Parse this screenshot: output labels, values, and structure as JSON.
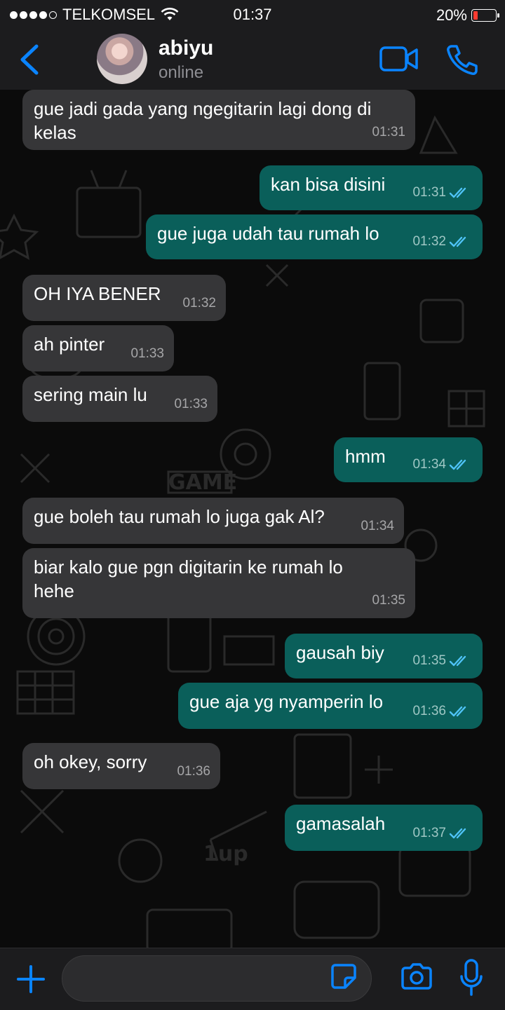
{
  "status_bar": {
    "carrier": "TELKOMSEL",
    "time": "01:37",
    "battery": "20%",
    "battery_level": 0.2
  },
  "header": {
    "name": "abiyu",
    "status": "online"
  },
  "colors": {
    "accent": "#0a84ff",
    "incoming": "#363638",
    "outgoing": "#0a5f5a",
    "read_tick": "#4fc3f7"
  },
  "messages": [
    {
      "dir": "in",
      "text": "gue jadi gada yang ngegitarin lagi dong di\nkelas",
      "time": "01:31"
    },
    {
      "dir": "out",
      "text": "kan bisa disini",
      "time": "01:31"
    },
    {
      "dir": "out",
      "text": "gue juga udah tau rumah lo",
      "time": "01:32"
    },
    {
      "dir": "in",
      "text": "OH IYA BENER",
      "time": "01:32"
    },
    {
      "dir": "in",
      "text": "ah pinter",
      "time": "01:33"
    },
    {
      "dir": "in",
      "text": "sering main lu",
      "time": "01:33"
    },
    {
      "dir": "out",
      "text": "hmm",
      "time": "01:34"
    },
    {
      "dir": "in",
      "text": "gue boleh tau rumah lo juga gak Al?",
      "time": "01:34"
    },
    {
      "dir": "in",
      "text": "biar kalo gue pgn digitarin ke rumah lo\nhehe",
      "time": "01:35"
    },
    {
      "dir": "out",
      "text": "gausah biy",
      "time": "01:35"
    },
    {
      "dir": "out",
      "text": "gue aja yg nyamperin lo",
      "time": "01:36"
    },
    {
      "dir": "in",
      "text": "oh okey, sorry",
      "time": "01:36"
    },
    {
      "dir": "out",
      "text": "gamasalah",
      "time": "01:37"
    }
  ],
  "icons": {
    "back": "chevron-left-icon",
    "video": "video-call-icon",
    "call": "phone-icon",
    "plus": "plus-icon",
    "sticker": "sticker-icon",
    "camera": "camera-icon",
    "mic": "microphone-icon"
  }
}
